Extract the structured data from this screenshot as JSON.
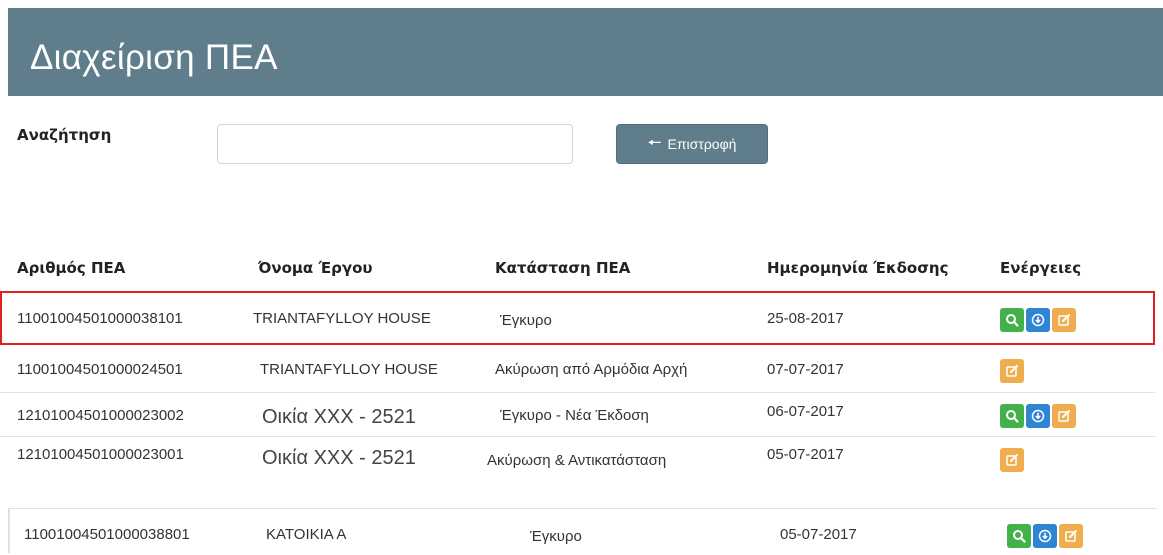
{
  "page": {
    "title": "Διαχείριση ΠΕΑ"
  },
  "search": {
    "label": "Αναζήτηση",
    "value": "",
    "placeholder": ""
  },
  "back_button": {
    "label": "Επιστροφή",
    "icon": "arrow-left-icon"
  },
  "table": {
    "headers": [
      "Αριθμός ΠΕΑ",
      "Όνομα Έργου",
      "Κατάσταση ΠΕΑ",
      "Ημερομηνία Έκδοσης",
      "Ενέργειες"
    ],
    "rows": [
      {
        "number": "11001004501000038101",
        "project": "TRIANTAFYLLOY HOUSE",
        "status": "Έγκυρο",
        "date": "25-08-2017",
        "actions": [
          "view",
          "download",
          "edit"
        ]
      },
      {
        "number": "11001004501000024501",
        "project": "TRIANTAFYLLOY HOUSE",
        "status": "Ακύρωση από Αρμόδια Αρχή",
        "date": "07-07-2017",
        "actions": [
          "edit"
        ]
      },
      {
        "number": "12101004501000023002",
        "project": "Οικία ΧΧΧ - 2521",
        "status": "Έγκυρο - Νέα Έκδοση",
        "date": "06-07-2017",
        "actions": [
          "view",
          "download",
          "edit"
        ]
      },
      {
        "number": "12101004501000023001",
        "project": "Οικία ΧΧΧ - 2521",
        "status": "Ακύρωση & Αντικατάσταση",
        "date": "05-07-2017",
        "actions": [
          "edit"
        ]
      },
      {
        "number": "11001004501000038801",
        "project": "ΚΑΤΟΙΚΙΑ Α",
        "status": "Έγκυρο",
        "date": "05-07-2017",
        "actions": [
          "view",
          "download",
          "edit"
        ]
      }
    ]
  },
  "colors": {
    "header_bg": "#607d8b",
    "view_button": "#43b049",
    "download_button": "#2e86d3",
    "edit_button": "#f0ad4e",
    "highlight": "#e02020"
  }
}
